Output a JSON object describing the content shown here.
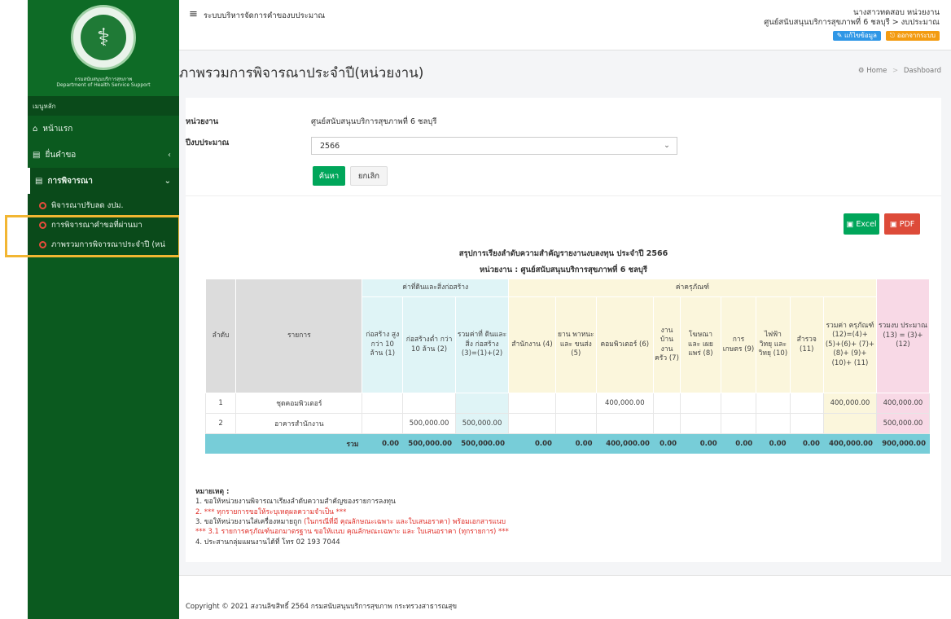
{
  "colors": {
    "sidebar": "#0b5a1f",
    "accent_green": "#00a65a",
    "pdf_red": "#dd4b39",
    "highlight": "#f2b632"
  },
  "sidebar": {
    "logo_caption": "กรมสนับสนุนบริการสุขภาพ",
    "logo_caption_en": "Department of Health Service Support",
    "menu_header": "เมนูหลัก",
    "items": [
      {
        "label": "หน้าแรก",
        "icon": "home-icon"
      },
      {
        "label": "ยื่นคำขอ",
        "icon": "document-icon"
      },
      {
        "label": "การพิจารณา",
        "icon": "document-icon"
      }
    ],
    "subitems": [
      "พิจารณาปรับลด งปม.",
      "การพิจารณาคำขอที่ผ่านมา",
      "ภาพรวมการพิจารณาประจำปี (หน่"
    ]
  },
  "header": {
    "system_title": "ระบบบริหารจัดการคำของบประมาณ",
    "user_name": "นางสาวทดสอบ หน่วยงาน",
    "user_unit": "ศูนย์สนับสนุนบริการสุขภาพที่ 6 ชลบุรี > งบประมาณ",
    "edit_profile": "แก้ไขข้อมูล",
    "logout": "ออกจากระบบ"
  },
  "page": {
    "title": "ภาพรวมการพิจารณาประจำปี(หน่วยงาน)",
    "breadcrumb_home": "Home",
    "breadcrumb_current": "Dashboard"
  },
  "form": {
    "agency_label": "หน่วยงาน",
    "agency_value": "ศูนย์สนับสนุนบริการสุขภาพที่ 6 ชลบุรี",
    "year_label": "ปีงบประมาณ",
    "year_value": "2566",
    "search_button": "ค้นหา",
    "cancel_button": "ยกเลิก"
  },
  "export": {
    "excel": "Excel",
    "pdf": "PDF"
  },
  "report": {
    "title": "สรุปการเรียงลำดับความสำคัญรายงานงบลงทุน ประจำปี 2566",
    "subtitle": "หน่วยงาน : ศูนย์สนับสนุนบริการสุขภาพที่ 6 ชลบุรี",
    "headers": {
      "no": "ลำดับ",
      "item": "รายการ",
      "group_land": "ค่าที่ดินและสิ่งก่อสร้าง",
      "group_equip": "ค่าครุภัณฑ์",
      "c1": "ก่อสร้าง สูงกว่า 10 ล้าน (1)",
      "c2": "ก่อสร้างต่ำ กว่า 10 ล้าน (2)",
      "c3": "รวมค่าที่ ดินและสิ่ง ก่อสร้าง (3)=(1)+(2)",
      "c4": "สำนักงาน (4)",
      "c5": "ยาน พาหนะ และ ขนส่ง (5)",
      "c6": "คอมพิวเตอร์ (6)",
      "c7": "งาน บ้าน งาน ครัว (7)",
      "c8": "โฆษณา และ เผย แพร่ (8)",
      "c9": "การ เกษตร (9)",
      "c10": "ไฟฟ้า วิทยุ และ วิทยุ (10)",
      "c11": "สำรวจ (11)",
      "c12": "รวมค่า ครุภัณฑ์ (12)=(4)+ (5)+(6)+ (7)+(8)+ (9)+(10)+ (11)",
      "c13": "รวมงบ ประมาณ (13) = (3)+ (12)"
    },
    "rows": [
      {
        "no": "1",
        "item": "ชุดคอมพิวเตอร์",
        "c1": "",
        "c2": "",
        "c3": "",
        "c4": "",
        "c5": "",
        "c6": "400,000.00",
        "c7": "",
        "c8": "",
        "c9": "",
        "c10": "",
        "c11": "",
        "c12": "400,000.00",
        "c13": "400,000.00"
      },
      {
        "no": "2",
        "item": "อาคารสำนักงาน",
        "c1": "",
        "c2": "500,000.00",
        "c3": "500,000.00",
        "c4": "",
        "c5": "",
        "c6": "",
        "c7": "",
        "c8": "",
        "c9": "",
        "c10": "",
        "c11": "",
        "c12": "",
        "c13": "500,000.00"
      }
    ],
    "total": {
      "label": "รวม",
      "c1": "0.00",
      "c2": "500,000.00",
      "c3": "500,000.00",
      "c4": "0.00",
      "c5": "0.00",
      "c6": "400,000.00",
      "c7": "0.00",
      "c8": "0.00",
      "c9": "0.00",
      "c10": "0.00",
      "c11": "0.00",
      "c12": "400,000.00",
      "c13": "900,000.00"
    }
  },
  "notes": {
    "heading": "หมายเหตุ :",
    "n1": "1. ขอให้หน่วยงานพิจารณาเรียงลำดับความสำคัญของรายการลงทุน",
    "n2": "2. *** ทุกรายการขอให้ระบุเหตุผลความจำเป็น ***",
    "n3a": "3. ขอให้หน่วยงานใส่เครื่องหมายถูก ",
    "n3b": "(ในกรณีที่มี คุณลักษณะเฉพาะ และใบเสนอราคา) พร้อมเอกสารแนบ",
    "n31a": "*** 3.1 รายการครุภัณฑ์นอกมาตรฐาน ขอให้แนบ ",
    "n31b": "คุณลักษณะเฉพาะ และ ใบเสนอราคา",
    "n31c": " (ทุกรายการ) ***",
    "n4": "4. ประสานกลุ่มแผนงานได้ที่ โทร 02 193 7044"
  },
  "footer": {
    "text": "Copyright © 2021 สงวนลิขสิทธิ์ 2564 กรมสนับสนุนบริการสุขภาพ กระทรวงสาธารณสุข"
  }
}
